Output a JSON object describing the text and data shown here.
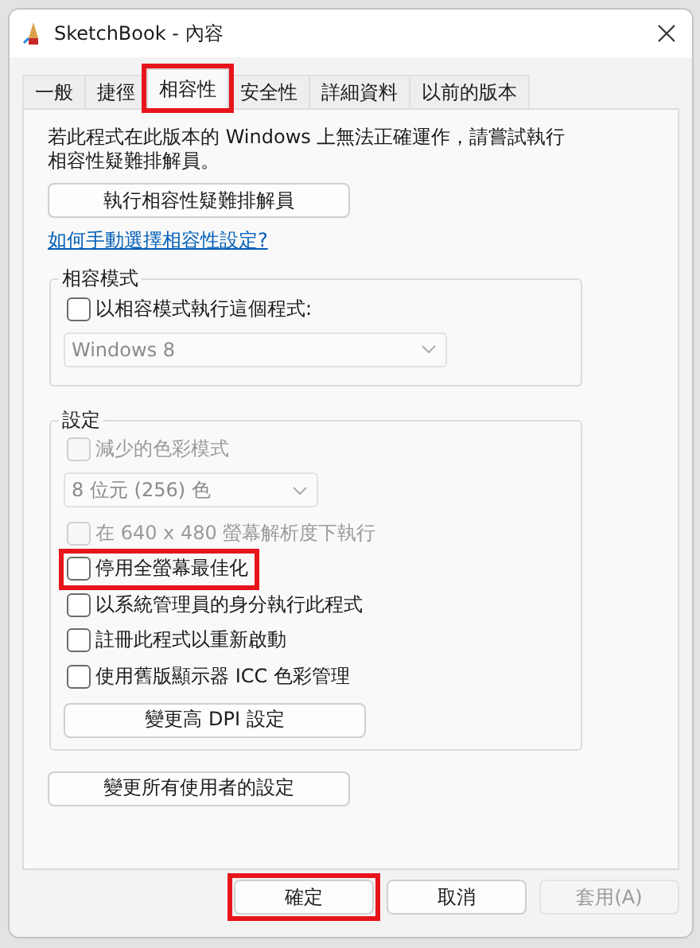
{
  "window": {
    "title": "SketchBook - 內容"
  },
  "tabs": [
    {
      "label": "一般",
      "selected": false,
      "highlighted": false
    },
    {
      "label": "捷徑",
      "selected": false,
      "highlighted": false
    },
    {
      "label": "相容性",
      "selected": true,
      "highlighted": true
    },
    {
      "label": "安全性",
      "selected": false,
      "highlighted": false
    },
    {
      "label": "詳細資料",
      "selected": false,
      "highlighted": false
    },
    {
      "label": "以前的版本",
      "selected": false,
      "highlighted": false
    }
  ],
  "intro": "若此程式在此版本的 Windows 上無法正確運作，請嘗試執行相容性疑難排解員。",
  "troubleshooter_button": "執行相容性疑難排解員",
  "help_link": "如何手動選擇相容性設定?",
  "compat_mode": {
    "title": "相容模式",
    "items": [
      {
        "kind": "checkbox",
        "label": "以相容模式執行這個程式:",
        "checked": false,
        "disabled": false,
        "highlighted": false
      },
      {
        "kind": "dropdown",
        "value": "Windows 8",
        "disabled": true
      }
    ]
  },
  "settings": {
    "title": "設定",
    "items": [
      {
        "kind": "checkbox",
        "label": "減少的色彩模式",
        "checked": false,
        "disabled": true,
        "highlighted": false
      },
      {
        "kind": "dropdown",
        "value": "8 位元 (256) 色",
        "disabled": true
      },
      {
        "kind": "checkbox",
        "label": "在 640 x 480 螢幕解析度下執行",
        "checked": false,
        "disabled": true,
        "highlighted": false
      },
      {
        "kind": "checkbox",
        "label": "停用全螢幕最佳化",
        "checked": false,
        "disabled": false,
        "highlighted": true
      },
      {
        "kind": "checkbox",
        "label": "以系統管理員的身分執行此程式",
        "checked": false,
        "disabled": false,
        "highlighted": false
      },
      {
        "kind": "checkbox",
        "label": "註冊此程式以重新啟動",
        "checked": false,
        "disabled": false,
        "highlighted": false
      },
      {
        "kind": "checkbox",
        "label": "使用舊版顯示器 ICC 色彩管理",
        "checked": false,
        "disabled": false,
        "highlighted": false
      },
      {
        "kind": "button",
        "label": "變更高 DPI 設定"
      }
    ]
  },
  "all_users_button": "變更所有使用者的設定",
  "buttons": [
    {
      "label": "確定",
      "disabled": false,
      "highlighted": true
    },
    {
      "label": "取消",
      "disabled": false,
      "highlighted": false
    },
    {
      "label": "套用(A)",
      "disabled": true,
      "highlighted": false
    }
  ]
}
